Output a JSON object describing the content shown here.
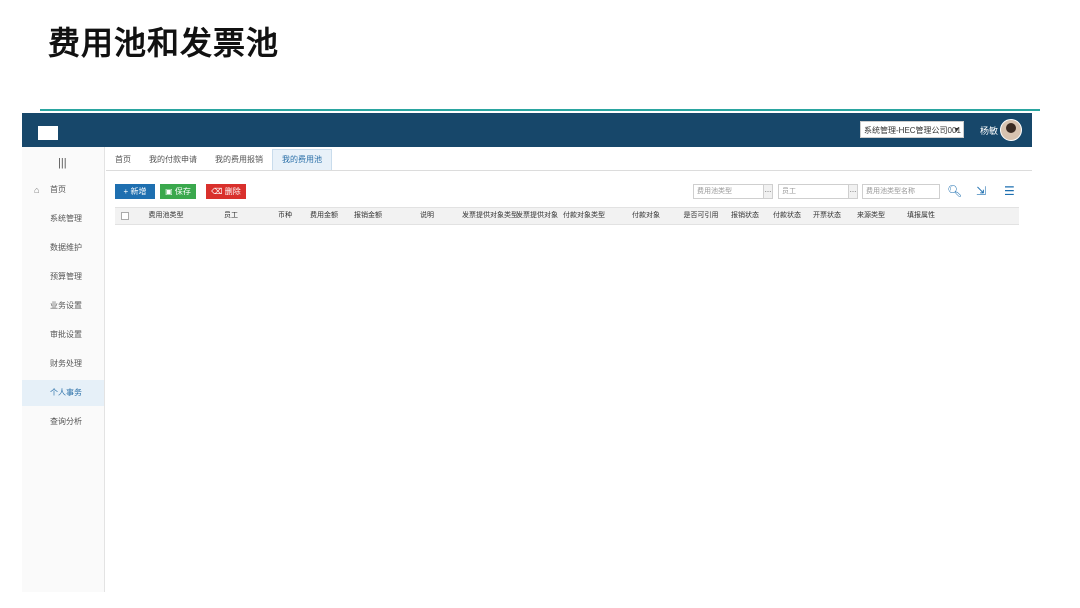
{
  "slide": {
    "title": "费用池和发票池"
  },
  "topbar": {
    "tenant": "系统管理-HEC管理公司001",
    "user": "杨敏"
  },
  "sidebar": {
    "items": [
      "首页",
      "系统管理",
      "数据维护",
      "预算管理",
      "业务设置",
      "审批设置",
      "财务处理",
      "个人事务",
      "查询分析"
    ]
  },
  "tabs": [
    "首页",
    "我的付款申请",
    "我的费用报销",
    "我的费用池"
  ],
  "toolbar": {
    "new_label": "+ 新增",
    "save_label": "保存",
    "delete_label": "删除"
  },
  "filters": {
    "expense_type_placeholder": "费用池类型",
    "employee_placeholder": "员工",
    "pool_name_placeholder": "费用池类型名称"
  },
  "pool_table": {
    "columns": [
      "费用池类型",
      "员工",
      "币种",
      "费用金额",
      "报销金额",
      "说明",
      "发票提供对象类型",
      "发票提供对象",
      "付款对象类型",
      "付款对象",
      "是否可引用",
      "报销状态",
      "付款状态",
      "开票状态",
      "来源类型",
      "填报属性"
    ]
  }
}
